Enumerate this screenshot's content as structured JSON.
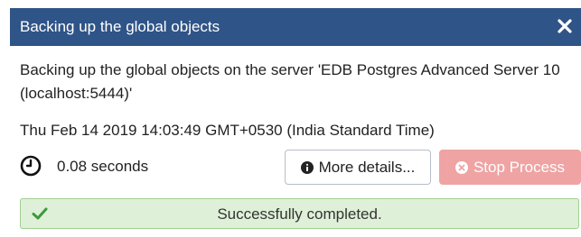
{
  "dialog": {
    "title": "Backing up the global objects",
    "message": "Backing up the global objects on the server 'EDB Postgres Advanced Server 10 (localhost:5444)'",
    "timestamp": "Thu Feb 14 2019 14:03:49 GMT+0530 (India Standard Time)",
    "elapsed": "0.08 seconds",
    "buttons": {
      "more_details": "More details...",
      "stop_process": "Stop Process"
    },
    "status": "Successfully completed."
  },
  "icons": {
    "close": "close-icon",
    "clock": "clock-icon",
    "info": "info-icon",
    "stop": "times-circle-icon",
    "check": "check-icon"
  },
  "colors": {
    "titlebar": "#2f5487",
    "stop_button": "#efa3a3",
    "success_bg": "#dff0d8",
    "success_border": "#9fcf8f",
    "success_check": "#3c9a3c"
  }
}
